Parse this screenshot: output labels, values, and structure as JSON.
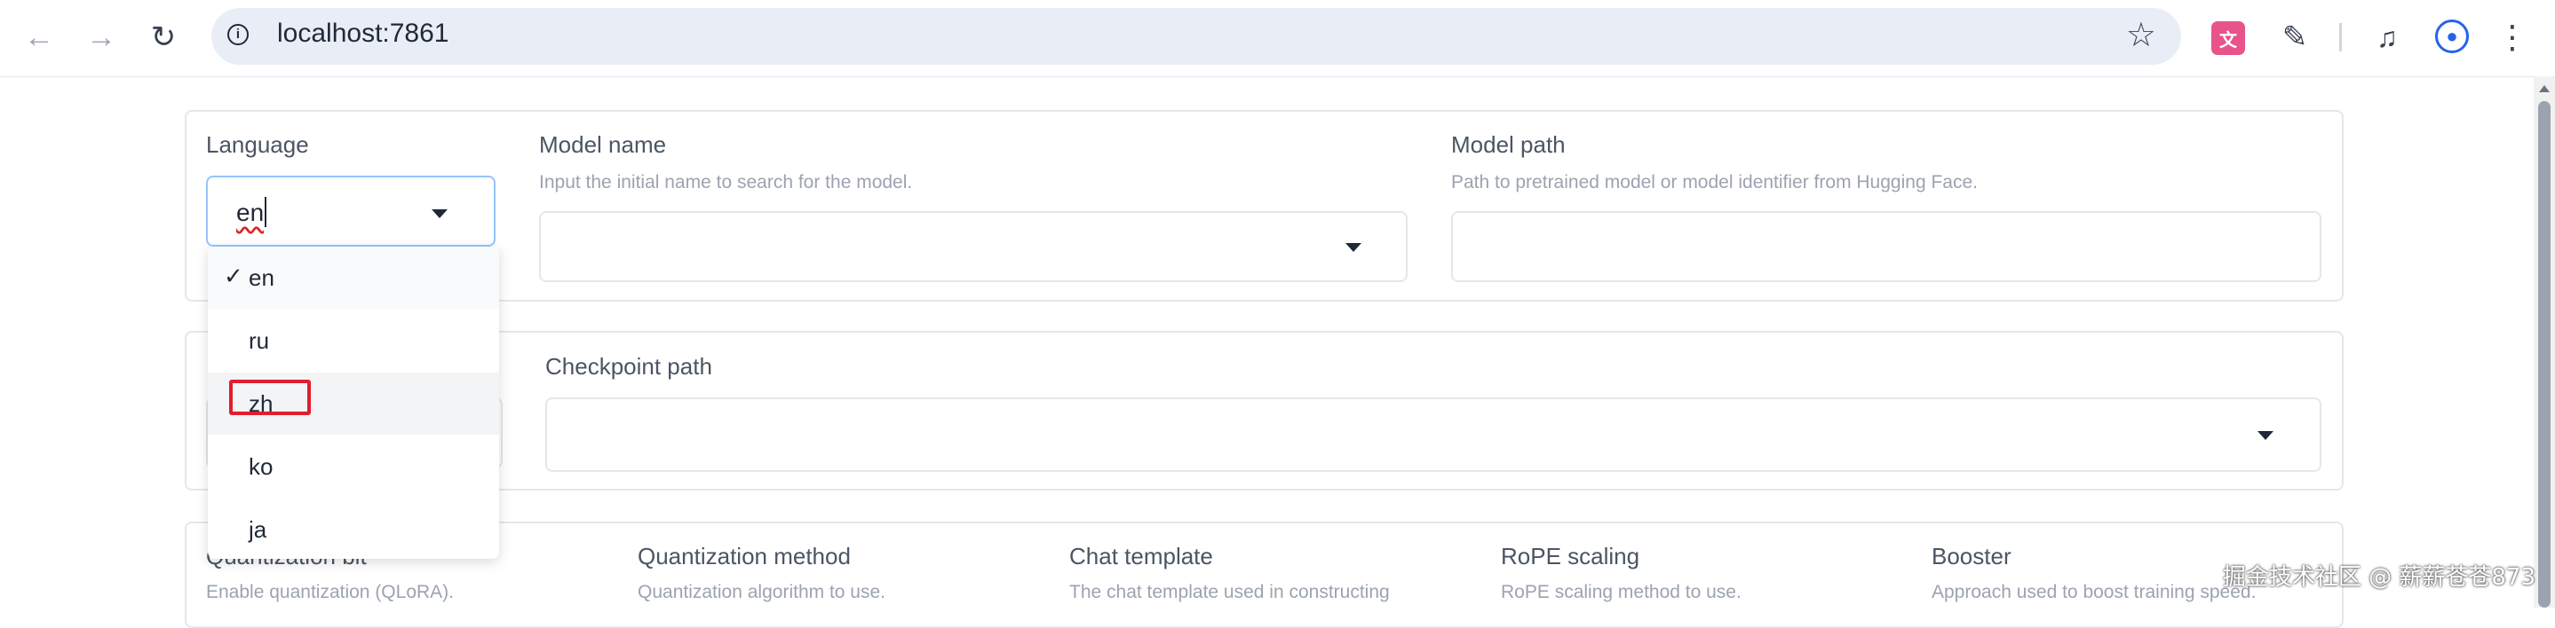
{
  "browser": {
    "url": "localhost:7861",
    "icons": {
      "back": "arrow-left-icon",
      "forward": "arrow-right-icon",
      "reload": "reload-icon",
      "site_info": "info-icon",
      "bookmark": "star-icon",
      "translate": "translate-extension-icon",
      "extensions": "puzzle-icon",
      "media": "media-control-icon",
      "profile": "profile-icon",
      "menu": "kebab-menu-icon"
    }
  },
  "row1": {
    "language_label": "Language",
    "language_value": "en",
    "model_name_label": "Model name",
    "model_name_hint": "Input the initial name to search for the model.",
    "model_path_label": "Model path",
    "model_path_hint": "Path to pretrained model or model identifier from Hugging Face."
  },
  "language_dropdown": {
    "selected": "en",
    "options": [
      "en",
      "ru",
      "zh",
      "ko",
      "ja"
    ],
    "highlighted": "zh"
  },
  "row2": {
    "checkpoint_label": "Checkpoint path"
  },
  "row3": {
    "columns": [
      {
        "label": "Quantization bit",
        "hint": "Enable quantization (QLoRA)."
      },
      {
        "label": "Quantization method",
        "hint": "Quantization algorithm to use."
      },
      {
        "label": "Chat template",
        "hint": "The chat template used in constructing"
      },
      {
        "label": "RoPE scaling",
        "hint": "RoPE scaling method to use."
      },
      {
        "label": "Booster",
        "hint": "Approach used to boost training speed."
      }
    ]
  },
  "watermark": "掘金技术社区 @ 薪薪苍苍873",
  "colors": {
    "focus_border": "#93c5fd",
    "highlight_box": "#e11d2e",
    "translate_ext": "#e8548a",
    "profile": "#2563eb"
  }
}
